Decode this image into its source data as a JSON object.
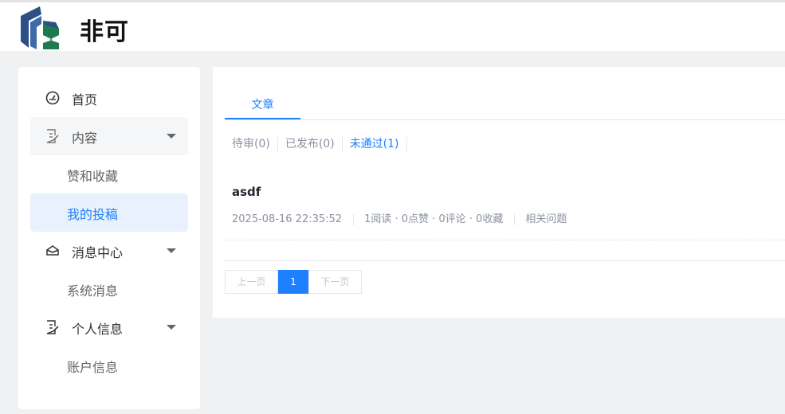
{
  "header": {
    "brand": "非可"
  },
  "sidebar": {
    "home": "首页",
    "content": {
      "label": "内容",
      "items": [
        "赞和收藏",
        "我的投稿"
      ]
    },
    "messages": {
      "label": "消息中心",
      "items": [
        "系统消息"
      ]
    },
    "profile": {
      "label": "个人信息",
      "items": [
        "账户信息"
      ]
    }
  },
  "main": {
    "tab": "文章",
    "filters": [
      "待审(0)",
      "已发布(0)",
      "未通过(1)"
    ],
    "active_filter": "未通过(1)",
    "article": {
      "title": "asdf",
      "date": "2025-08-16 22:35:52",
      "stats": "1阅读 · 0点赞 · 0评论 · 0收藏",
      "related": "相关问题"
    },
    "pagination": {
      "prev": "上一页",
      "current": "1",
      "next": "下一页"
    }
  },
  "colors": {
    "accent": "#1e80ff",
    "logo_blue": "#2b4f86",
    "logo_green": "#1f7a4d"
  }
}
